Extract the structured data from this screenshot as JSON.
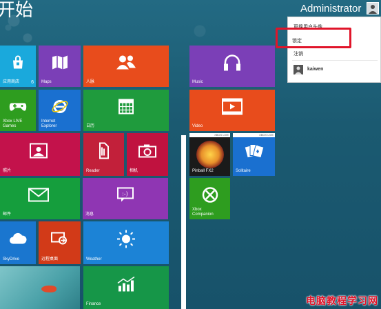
{
  "screen": {
    "title": "开始",
    "account_name": "Administrator"
  },
  "user_menu": {
    "items": [
      {
        "label": "更换用户头像"
      },
      {
        "label": "锁定"
      },
      {
        "label": "注销"
      }
    ],
    "other_user": "kaiwen"
  },
  "tiles": [
    {
      "id": "store",
      "label": "应用商店",
      "badge": "6",
      "color": "#1aa9dc",
      "icon": "shopping-bag-icon"
    },
    {
      "id": "maps",
      "label": "Maps",
      "color": "#7b3fb7",
      "icon": "map-icon"
    },
    {
      "id": "people",
      "label": "人脉",
      "color": "#e84c1c",
      "icon": "people-icon"
    },
    {
      "id": "xbox-live-games",
      "label": "Xbox LIVE\nGames",
      "color": "#2e9d1f",
      "icon": "game-controller-icon"
    },
    {
      "id": "internet-explorer",
      "label": "Internet\nExplorer",
      "color": "#1a70d0",
      "icon": "ie-logo-icon"
    },
    {
      "id": "calendar",
      "label": "日历",
      "color": "#1f9b3d",
      "icon": "calendar-icon"
    },
    {
      "id": "photos",
      "label": "照片",
      "color": "#c3124b",
      "icon": "photo-icon"
    },
    {
      "id": "reader",
      "label": "Reader",
      "color": "#c2203a",
      "icon": "reader-icon"
    },
    {
      "id": "camera",
      "label": "相机",
      "color": "#c0123f",
      "icon": "camera-icon"
    },
    {
      "id": "mail",
      "label": "邮件",
      "color": "#159e3d",
      "icon": "mail-icon"
    },
    {
      "id": "messaging",
      "label": "消息",
      "color": "#8f36b3",
      "icon": "chat-bubble-icon"
    },
    {
      "id": "skydrive",
      "label": "SkyDrive",
      "color": "#1a76cf",
      "icon": "cloud-icon"
    },
    {
      "id": "remote-desktop",
      "label": "远程桌面",
      "color": "#d23a18",
      "icon": "remote-desktop-icon"
    },
    {
      "id": "weather",
      "label": "Weather",
      "color": "#1c83d6",
      "icon": "sun-icon"
    },
    {
      "id": "finance",
      "label": "Finance",
      "color": "#169648",
      "icon": "chart-up-icon"
    },
    {
      "id": "music",
      "label": "Music",
      "color": "#7b3fb7",
      "icon": "headphones-icon"
    },
    {
      "id": "video",
      "label": "Video",
      "color": "#e84c1c",
      "icon": "play-icon"
    },
    {
      "id": "pinball-fx2",
      "label": "Pinball FX2",
      "badge": "XBOX LIVE",
      "color": "#1a1a1a",
      "icon": "pinball-art-icon"
    },
    {
      "id": "solitaire",
      "label": "Solitaire",
      "badge": "XBOX LIVE",
      "color": "#1a70d0",
      "icon": "cards-icon"
    },
    {
      "id": "xbox-companion",
      "label": "Xbox\nCompanion",
      "color": "#2e9d1f",
      "icon": "xbox-logo-icon"
    }
  ],
  "watermark": "电脑教程学习网",
  "colors": {
    "background": "#1d5b73",
    "highlight": "#e0152a"
  }
}
